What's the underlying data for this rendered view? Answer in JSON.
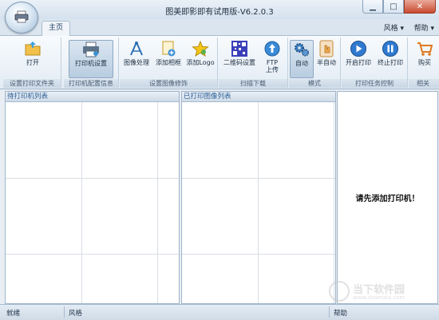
{
  "window": {
    "title": "图美即影即有试用版-V6.2.0.3"
  },
  "tabs": {
    "main": "主页"
  },
  "menus": {
    "style": "风格",
    "help": "帮助"
  },
  "ribbon": {
    "groups": [
      {
        "label": "设置打印文件夹",
        "buttons": [
          {
            "label": "打开"
          }
        ]
      },
      {
        "label": "打印机配置信息",
        "buttons": [
          {
            "label": "打印机设置"
          }
        ]
      },
      {
        "label": "设置图像修饰",
        "buttons": [
          {
            "label": "图像处理"
          },
          {
            "label": "添加相框"
          },
          {
            "label": "添加Logo"
          }
        ]
      },
      {
        "label": "扫描下载",
        "buttons": [
          {
            "label": "二维码设置"
          },
          {
            "label": "FTP上传"
          }
        ]
      },
      {
        "label": "模式",
        "buttons": [
          {
            "label": "自动"
          },
          {
            "label": "半自动"
          }
        ]
      },
      {
        "label": "打印任务控制",
        "buttons": [
          {
            "label": "开启打印"
          },
          {
            "label": "终止打印"
          }
        ]
      },
      {
        "label": "相关",
        "buttons": [
          {
            "label": "购买"
          }
        ]
      }
    ]
  },
  "panels": {
    "pending": {
      "title": "待打印机列表"
    },
    "printed": {
      "title": "已打印图像列表"
    },
    "notice": "请先添加打印机！"
  },
  "status": {
    "ready": "就绪",
    "style": "风格",
    "help": "帮助"
  },
  "watermark": {
    "text": "当下软件园",
    "url": "www.downxia.com"
  }
}
